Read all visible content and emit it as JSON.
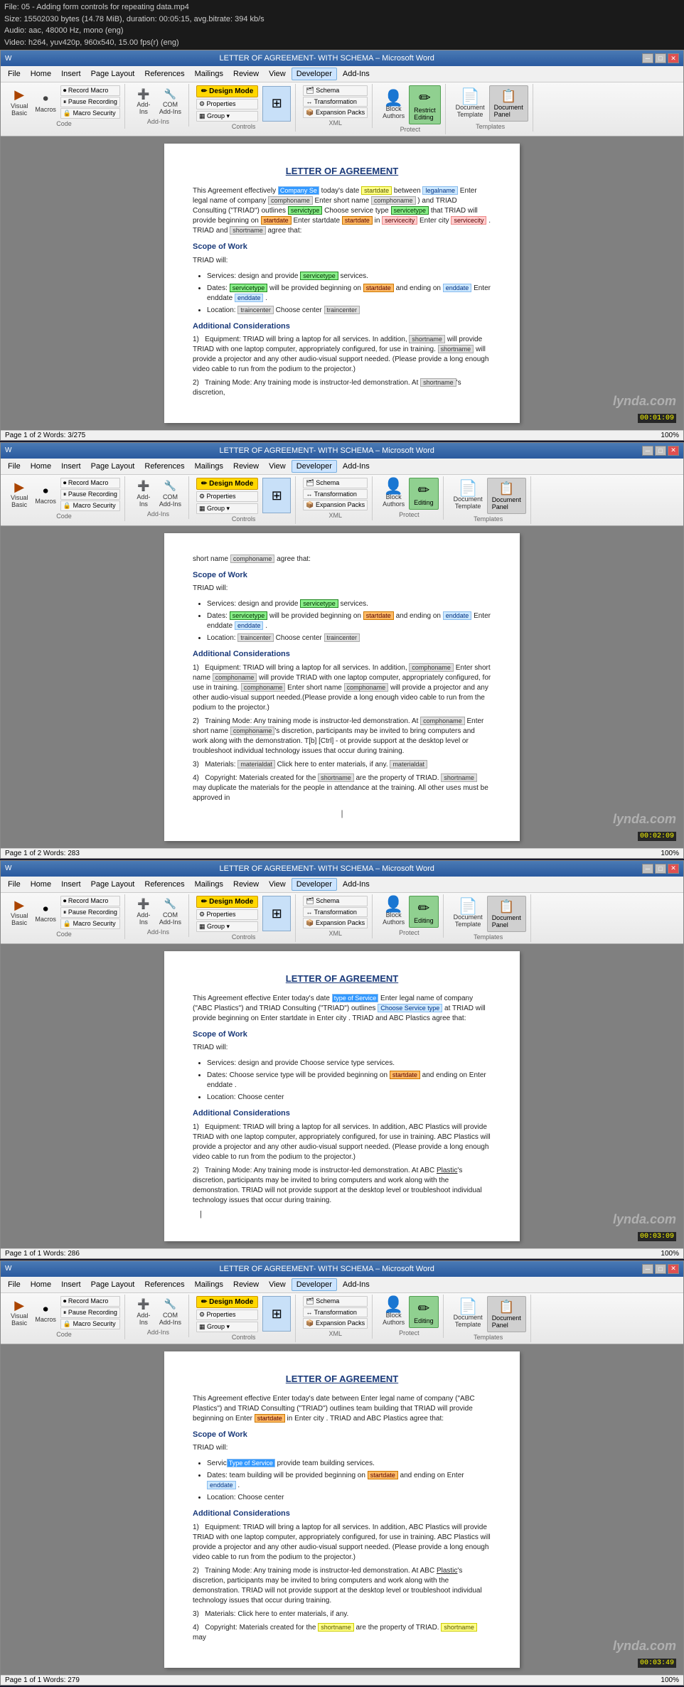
{
  "video_info": {
    "line1": "File: 05 - Adding form controls for repeating data.mp4",
    "line2": "Size: 15502030 bytes (14.78 MiB), duration: 00:05:15, avg.bitrate: 394 kb/s",
    "line3": "Audio: aac, 48000 Hz, mono (eng)",
    "line4": "Video: h264, yuv420p, 960x540, 15.00 fps(r) (eng)"
  },
  "windows": [
    {
      "id": "window1",
      "title": "LETTER OF AGREEMENT- WITH SCHEMA – Microsoft Word",
      "timecode": "00:01:09",
      "menu_items": [
        "File",
        "Home",
        "Insert",
        "Page Layout",
        "References",
        "Mailings",
        "Review",
        "View",
        "Developer",
        "Add-Ins"
      ],
      "active_menu": "Developer",
      "ribbon_groups": [
        {
          "label": "Code",
          "buttons": [
            "Visual Basic",
            "Macros",
            "Record Macro",
            "Pause Recording",
            "Macro Security"
          ]
        },
        {
          "label": "Add-Ins",
          "buttons": [
            "Add-Ins",
            "COM Add-Ins"
          ]
        },
        {
          "label": "Controls",
          "buttons": [
            "Design Mode",
            "Properties",
            "Group"
          ]
        },
        {
          "label": "XML",
          "buttons": [
            "Schema",
            "Transformation",
            "Expansion Packs"
          ]
        },
        {
          "label": "Protect",
          "buttons": [
            "Block Authors",
            "Restrict Editing"
          ]
        },
        {
          "label": "Templates",
          "buttons": [
            "Document Template",
            "Document Panel"
          ]
        }
      ],
      "editing_btn": "Editing",
      "templates_label": "Templates",
      "status": "Page 1 of 2  Words: 3/275",
      "zoom": "100%",
      "doc": {
        "title": "LETTER OF AGREEMENT",
        "body": [
          "This Agreement effectively Company Se today's date startdate between legalname Enter legal name of company comphoname Enter short name comphoname ) and TRIAD Consulting (\"TRIAD\") outlines servictype Choose service type servicetype that TRIAD will provide beginning on startdate Enter startdate startdate in servicecity Enter city servicecity . TRIAD and shortname agree that:",
          "Scope of Work",
          "TRIAD will:",
          "Services: design and provide servicetype services.",
          "Dates: servicetype will be provided beginning on startdate and ending on enddate Enter enddate enddate .",
          "Location: traincenter Choose center traincenter",
          "Additional Considerations",
          "1)  Equipment: TRIAD will bring a laptop for all services. In addition, shortname will provide TRIAD with one laptop computer, appropriately configured, for use in training. shortname will provide a projector and any other audio-visual support needed. (Please provide a long enough video cable to run from the podium to the projector.)",
          "2)  Training Mode: Any training mode is instructor-led demonstration. At shortname 's discretion,"
        ]
      }
    },
    {
      "id": "window2",
      "title": "LETTER OF AGREEMENT- WITH SCHEMA – Microsoft Word",
      "timecode": "00:02:09",
      "menu_items": [
        "File",
        "Home",
        "Insert",
        "Page Layout",
        "References",
        "Mailings",
        "Review",
        "View",
        "Developer",
        "Add-Ins"
      ],
      "active_menu": "Developer",
      "editing_btn": "Editing",
      "templates_label": "Templates",
      "status": "Page 1 of 2  Words: 283",
      "zoom": "100%",
      "doc": {
        "title": null,
        "body_prefix": "short name comphoname agree that:",
        "sections": [
          {
            "type": "section_title",
            "text": "Scope of Work"
          },
          {
            "type": "para",
            "text": "TRIAD will:"
          },
          {
            "type": "bullet",
            "text": "Services: design and provide servicetype services."
          },
          {
            "type": "bullet",
            "text": "Dates: servicetype will be provided beginning on startdate and ending on enddate Enter enddate enddate ."
          },
          {
            "type": "bullet",
            "text": "Location: traincenter Choose center traincenter"
          },
          {
            "type": "section_title",
            "text": "Additional Considerations"
          },
          {
            "type": "numbered",
            "num": "1)",
            "text": "Equipment: TRIAD will bring a laptop for all services. In addition, comphoname Enter short name comphoname will provide TRIAD with one laptop computer, appropriately configured, for use in training. comphoname Enter short name comphoname will provide a projector and any other audio-visual support needed.(Please provide a long enough video cable to run from the podium to the projector.)"
          },
          {
            "type": "numbered",
            "num": "2)",
            "text": "Training Mode: Any training mode is instructor-led demonstration. At comphoname Enter short name comphoname 's discretion, participants may be invited to bring computers and work along with the demonstration. T[b] [Ctrl] - ot provide support at the desktop level or troubleshoot individual technology issues that occur during training."
          },
          {
            "type": "numbered",
            "num": "3)",
            "text": "Materials: materialdat Click here to enter materials, if any. materialdat"
          },
          {
            "type": "numbered",
            "num": "4)",
            "text": "Copyright: Materials created for the shortname are the property of TRIAD. shortname may duplicate the materials for the people in attendance at the training. All other uses must be approved in"
          }
        ]
      }
    },
    {
      "id": "window3",
      "title": "LETTER OF AGREEMENT- WITH SCHEMA – Microsoft Word",
      "timecode": "00:03:09",
      "menu_items": [
        "File",
        "Home",
        "Insert",
        "Page Layout",
        "References",
        "Mailings",
        "Review",
        "View",
        "Developer",
        "Add-Ins"
      ],
      "active_menu": "Developer",
      "editing_btn": "Editing",
      "templates_label": "Templates",
      "status": "Page 1 of 1  Words: 286",
      "zoom": "100%",
      "doc": {
        "title": "LETTER OF AGREEMENT",
        "body": [
          "This Agreement effective Enter today's date type of Service Enter legal name of company (\"ABC Plastics\") and TRIAD Consulting (\"TRIAD\") outlines Choose Service type at TRIAD will provide beginning on Enter startdate in Enter city . TRIAD and ABC Plastics agree that:",
          "Scope of Work",
          "TRIAD will:",
          "Services: design and provide Choose service type services.",
          "Dates: Choose service type will be provided beginning on startdate and ending on Enter enddate .",
          "Location: Choose center",
          "Additional Considerations",
          "1)  Equipment: TRIAD will bring a laptop for all services. In addition, ABC Plastics will provide TRIAD with one laptop computer, appropriately configured, for use in training. ABC Plastics will provide a projector and any other audio-visual support needed. (Please provide a long enough video cable to run from the podium to the projector.)",
          "2)  Training Mode: Any training mode is instructor-led demonstration. At ABC Plastics's discretion, participants may be invited to bring computers and work along with the demonstration. TRIAD will not provide support at the desktop level or troubleshoot individual technology issues that occur during training."
        ]
      }
    },
    {
      "id": "window4",
      "title": "LETTER OF AGREEMENT- WITH SCHEMA – Microsoft Word",
      "timecode": "00:03:49",
      "menu_items": [
        "File",
        "Home",
        "Insert",
        "Page Layout",
        "References",
        "Mailings",
        "Review",
        "View",
        "Developer",
        "Add-Ins"
      ],
      "active_menu": "Developer",
      "editing_btn": "Editing",
      "templates_label": "Templates",
      "status": "Page 1 of 1  Words: 279",
      "zoom": "100%",
      "doc": {
        "title": "LETTER OF AGREEMENT",
        "body": [
          "This Agreement effective Enter today's date between Enter legal name of company (\"ABC Plastics\") and TRIAD Consulting (\"TRIAD\") outlines team building that TRIAD will provide beginning on Enter startdate in Enter city . TRIAD and ABC Plastics agree that:",
          "Scope of Work",
          "TRIAD will:",
          "Services: Type of Service provide team building services.",
          "Dates: team building will be provided beginning on startdate and ending on Enter enddate .",
          "Location: Choose center",
          "Additional Considerations",
          "1)  Equipment: TRIAD will bring a laptop for all services. In addition, ABC Plastics will provide TRIAD with one laptop computer, appropriately configured, for use in training. ABC Plastics will provide a projector and any other audio-visual support needed. (Please provide a long enough video cable to run from the podium to the projector.)",
          "2)  Training Mode: Any training mode is instructor-led demonstration. At ABC Plastics's discretion, participants may be invited to bring computers and work along with the demonstration. TRIAD will not provide support at the desktop level or troubleshoot individual technology issues that occur during training.",
          "3)  Materials: Click here to enter materials, if any.",
          "4)  Copyright: Materials created for the shortname are the property of TRIAD. shortname may"
        ]
      }
    }
  ],
  "icons": {
    "macro": "⏺",
    "pause": "⏸",
    "security": "🔒",
    "schema": "🗂",
    "properties": "⚙",
    "group": "▦",
    "block": "🚫",
    "restrict": "✏",
    "doc_template": "📄",
    "doc_panel": "📋",
    "visual_basic": "▶",
    "add_ins": "➕",
    "com": "🔧",
    "design_mode": "✏",
    "transformation": "↔",
    "expansion": "📦",
    "scroll_up": "▲",
    "scroll_down": "▼",
    "minimize": "─",
    "maximize": "□",
    "close": "✕"
  },
  "colors": {
    "title_bar": "#2a5a9f",
    "menu_active": "#cce4ff",
    "design_mode_bg": "#ffd700",
    "editing_bg": "#90d090",
    "doc_title_color": "#1a3a7a",
    "field_blue_bg": "#cce8ff",
    "field_yellow_bg": "#ffff88",
    "field_green_bg": "#88ee88",
    "field_orange_bg": "#ffbb66",
    "field_gray_bg": "#e0e0e0",
    "field_pink_bg": "#ffcccc"
  }
}
